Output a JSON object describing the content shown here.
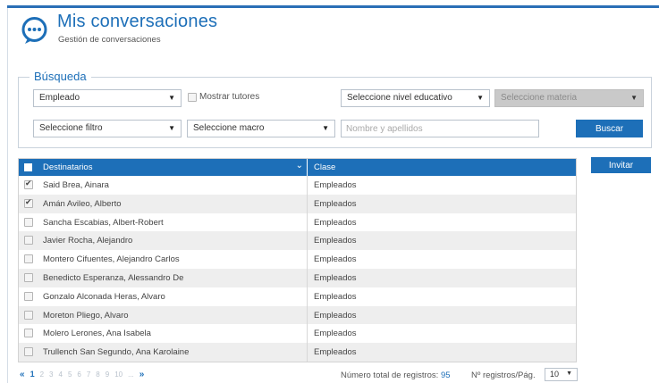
{
  "header": {
    "title": "Mis conversaciones",
    "subtitle": "Gestión de conversaciones"
  },
  "search": {
    "legend": "Búsqueda",
    "role_select": "Empleado",
    "show_tutors_label": "Mostrar tutores",
    "level_select": "Seleccione nivel educativo",
    "subject_select": "Seleccione materia",
    "filter_select": "Seleccione filtro",
    "macro_select": "Seleccione macro",
    "name_placeholder": "Nombre y apellidos",
    "search_button": "Buscar"
  },
  "invite_button": "Invitar",
  "table": {
    "headers": {
      "recipients": "Destinatarios",
      "class": "Clase"
    },
    "rows": [
      {
        "name": "Said Brea, Ainara",
        "class": "Empleados",
        "checked": true
      },
      {
        "name": "Amán Avileo, Alberto",
        "class": "Empleados",
        "checked": true
      },
      {
        "name": "Sancha Escabias, Albert-Robert",
        "class": "Empleados",
        "checked": false
      },
      {
        "name": "Javier Rocha, Alejandro",
        "class": "Empleados",
        "checked": false
      },
      {
        "name": "Montero Cifuentes, Alejandro Carlos",
        "class": "Empleados",
        "checked": false
      },
      {
        "name": "Benedicto Esperanza, Alessandro De",
        "class": "Empleados",
        "checked": false
      },
      {
        "name": "Gonzalo Alconada Heras, Alvaro",
        "class": "Empleados",
        "checked": false
      },
      {
        "name": "Moreton Pliego, Alvaro",
        "class": "Empleados",
        "checked": false
      },
      {
        "name": "Molero Lerones, Ana Isabela",
        "class": "Empleados",
        "checked": false
      },
      {
        "name": "Trullench San Segundo, Ana Karolaine",
        "class": "Empleados",
        "checked": false
      }
    ]
  },
  "pagination": {
    "first": "«",
    "pages": [
      "1",
      "2",
      "3",
      "4",
      "5",
      "6",
      "7",
      "8",
      "9",
      "10",
      "..."
    ],
    "current": "1",
    "next": "»",
    "total_label": "Número total de registros:",
    "total_value": "95",
    "per_page_label": "Nº registros/Pág.",
    "per_page_value": "10"
  },
  "colors": {
    "accent": "#1d6fb8",
    "disabled": "#c9c9c9",
    "row_alt": "#eeeeee"
  }
}
